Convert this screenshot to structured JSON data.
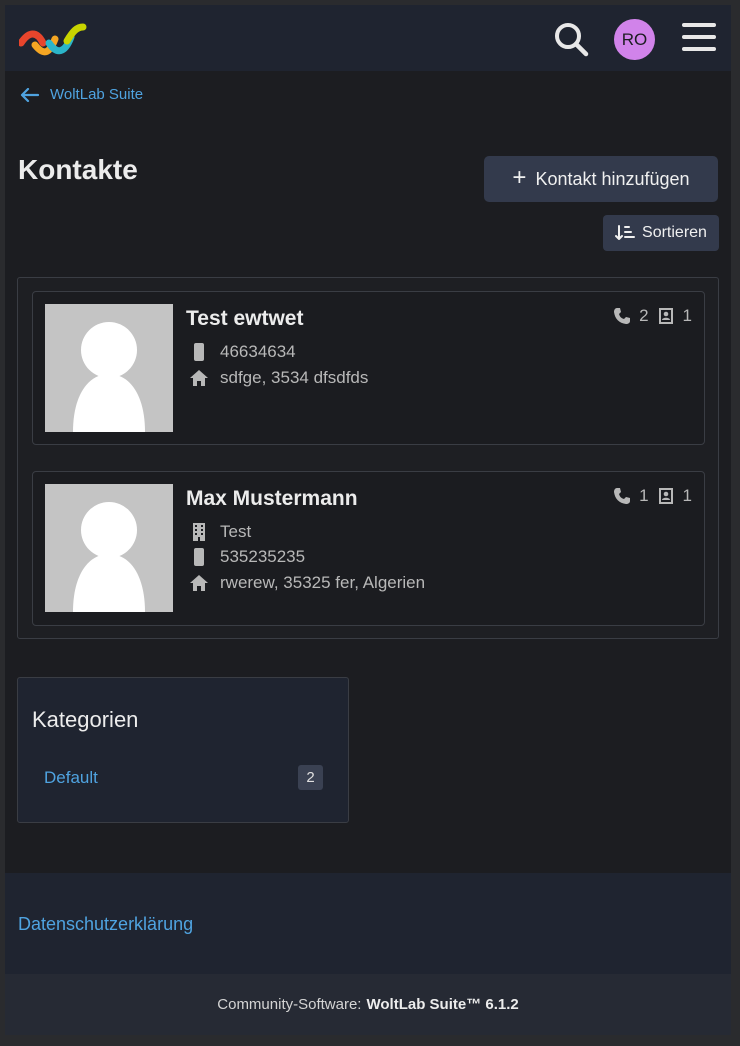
{
  "header": {
    "logo_icon": "woltlab-logo-icon",
    "search_icon": "search-icon",
    "avatar_initials": "RO",
    "avatar_color": "#d183ea",
    "menu_icon": "hamburger-menu-icon"
  },
  "breadcrumb": {
    "label": "WoltLab Suite"
  },
  "page": {
    "title": "Kontakte",
    "add_button_label": "Kontakt hinzufügen",
    "sort_button_label": "Sortieren"
  },
  "contacts": [
    {
      "name": "Test ewtwet",
      "phone": "46634634",
      "address": "sdfge, 3534 dfsdfds",
      "phone_count": "2",
      "card_count": "1"
    },
    {
      "name": "Max Mustermann",
      "company": "Test",
      "phone": "535235235",
      "address": "rwerew, 35325 fer, Algerien",
      "phone_count": "1",
      "card_count": "1"
    }
  ],
  "categories": {
    "title": "Kategorien",
    "items": [
      {
        "label": "Default",
        "count": "2"
      }
    ]
  },
  "footer": {
    "privacy_link": "Datenschutzerklärung",
    "copyright_prefix": "Community-Software:",
    "copyright_product": "WoltLab Suite™ 6.1.2"
  },
  "colors": {
    "background": "#1c1d21",
    "header": "#1f2430",
    "link": "#4fa3e0",
    "button": "#333a4c"
  }
}
